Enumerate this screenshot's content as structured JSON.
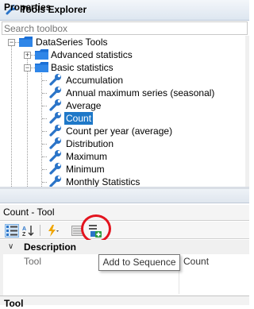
{
  "tools_explorer": {
    "title": "Tools Explorer",
    "search_placeholder": "Search toolbox"
  },
  "tree": {
    "root": {
      "label": "DataSeries Tools",
      "icon": "folder-icon",
      "expanded": true
    },
    "groups": [
      {
        "label": "Advanced statistics",
        "icon": "folder-icon",
        "expanded": false
      },
      {
        "label": "Basic statistics",
        "icon": "folder-icon",
        "expanded": true
      }
    ],
    "tools": [
      {
        "label": "Accumulation",
        "icon": "wrench-icon"
      },
      {
        "label": "Annual maximum series (seasonal)",
        "icon": "wrench-icon"
      },
      {
        "label": "Average",
        "icon": "wrench-icon"
      },
      {
        "label": "Count",
        "icon": "wrench-icon",
        "selected": true
      },
      {
        "label": "Count per year (average)",
        "icon": "wrench-icon"
      },
      {
        "label": "Distribution",
        "icon": "wrench-icon"
      },
      {
        "label": "Maximum",
        "icon": "wrench-icon"
      },
      {
        "label": "Minimum",
        "icon": "wrench-icon"
      },
      {
        "label": "Monthly Statistics",
        "icon": "wrench-icon"
      }
    ]
  },
  "properties": {
    "title": "Properties",
    "object_label": "Count - Tool",
    "toolbar": {
      "categorized_icon": "categorized-icon",
      "alphabetical_icon": "sort-az-icon",
      "events_icon": "lightning-icon",
      "pages_icon": "property-pages-icon",
      "add_to_sequence_icon": "add-to-sequence-icon"
    },
    "category": "Description",
    "rows": [
      {
        "key": "Tool",
        "value": "Count"
      }
    ],
    "tooltip": "Add to Sequence",
    "description_title": "Tool"
  },
  "colors": {
    "selection": "#1e78c8",
    "highlight_circle": "#e3141e",
    "folder": "#1a6fd6",
    "wrench": "#2a74c8"
  }
}
